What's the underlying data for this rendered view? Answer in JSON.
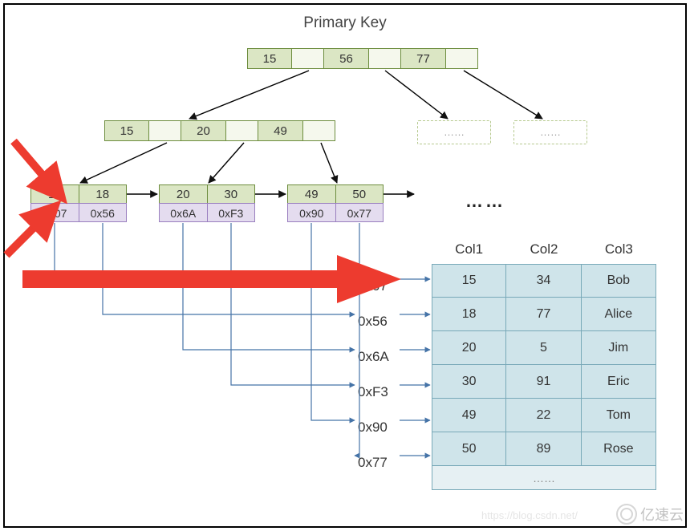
{
  "title": "Primary Key",
  "root": {
    "keys": [
      "15",
      "56",
      "77"
    ]
  },
  "inner": {
    "keys": [
      "15",
      "20",
      "49"
    ]
  },
  "ghosts": [
    "……",
    "……"
  ],
  "leaves": [
    {
      "keys": [
        "15",
        "18"
      ],
      "addrs": [
        "0x07",
        "0x56"
      ]
    },
    {
      "keys": [
        "20",
        "30"
      ],
      "addrs": [
        "0x6A",
        "0xF3"
      ]
    },
    {
      "keys": [
        "49",
        "50"
      ],
      "addrs": [
        "0x90",
        "0x77"
      ]
    }
  ],
  "leaf_dots": "……",
  "addr_list": [
    "0x07",
    "0x56",
    "0x6A",
    "0xF3",
    "0x90",
    "0x77"
  ],
  "table": {
    "headers": [
      "Col1",
      "Col2",
      "Col3"
    ],
    "rows": [
      [
        "15",
        "34",
        "Bob"
      ],
      [
        "18",
        "77",
        "Alice"
      ],
      [
        "20",
        "5",
        "Jim"
      ],
      [
        "30",
        "91",
        "Eric"
      ],
      [
        "49",
        "22",
        "Tom"
      ],
      [
        "50",
        "89",
        "Rose"
      ]
    ],
    "more": "……"
  },
  "watermark": "亿速云",
  "wm_url": "https://blog.csdn.net/"
}
